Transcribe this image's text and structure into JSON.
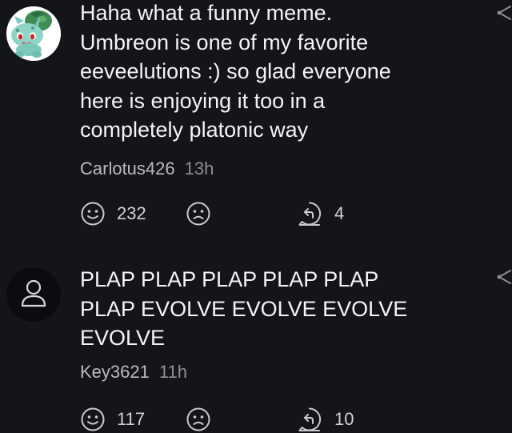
{
  "comments": [
    {
      "text": "Haha what a funny meme.\nUmbreon is one of my favorite\neeveelutions :) so glad everyone\nhere is enjoying it too in a\ncompletely platonic way",
      "author": "Carlotus426",
      "time": "13h",
      "likes": "232",
      "replies": "4",
      "avatar": "bulbasaur-avatar"
    },
    {
      "text": "PLAP PLAP PLAP PLAP PLAP\nPLAP EVOLVE EVOLVE EVOLVE\nEVOLVE",
      "author": "Key3621",
      "time": "11h",
      "likes": "117",
      "replies": "10",
      "avatar": "default-user-avatar"
    }
  ],
  "colors": {
    "background": "#141519",
    "text": "#f4f4f4",
    "meta": "#b9bbc0",
    "icon": "#c8cacf"
  }
}
